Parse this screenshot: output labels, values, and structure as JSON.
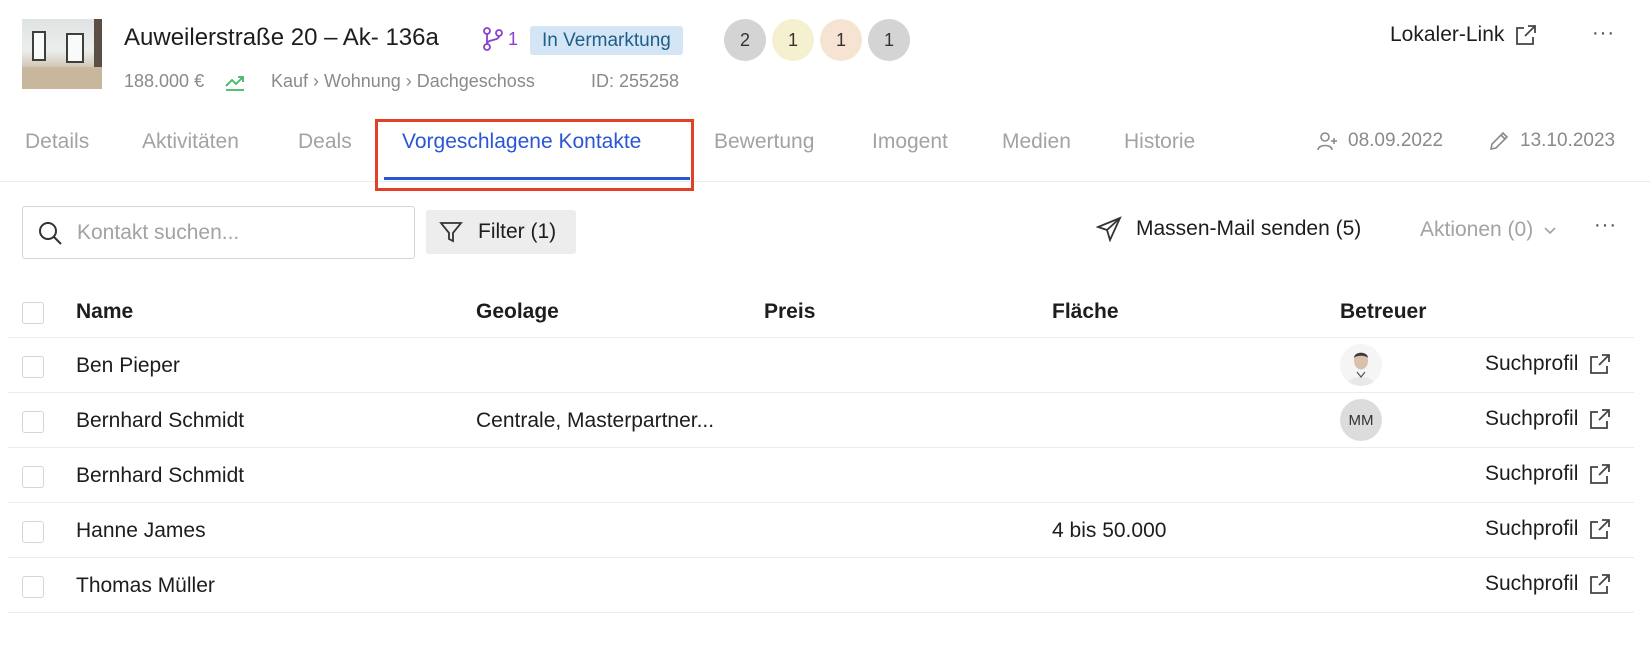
{
  "header": {
    "title": "Auweilerstraße 20 – Ak- 136a",
    "branch_count": "1",
    "status": "In Vermarktung",
    "circles": [
      {
        "value": "2",
        "color": "#d4d4d4"
      },
      {
        "value": "1",
        "color": "#f5f0cf"
      },
      {
        "value": "1",
        "color": "#f6e3d2"
      },
      {
        "value": "1",
        "color": "#d4d4d4"
      }
    ],
    "price": "188.000 €",
    "category": "Kauf › Wohnung › Dachgeschoss",
    "id_label": "ID: 255258",
    "local_link": "Lokaler-Link",
    "more_label": "···"
  },
  "tabs": [
    {
      "label": "Details",
      "key": "details"
    },
    {
      "label": "Aktivitäten",
      "key": "aktivitaeten"
    },
    {
      "label": "Deals",
      "key": "deals"
    },
    {
      "label": "Vorgeschlagene Kontakte",
      "key": "vorgeschlagene-kontakte",
      "active": true
    },
    {
      "label": "Bewertung",
      "key": "bewertung"
    },
    {
      "label": "Imogent",
      "key": "imogent"
    },
    {
      "label": "Medien",
      "key": "medien"
    },
    {
      "label": "Historie",
      "key": "historie"
    }
  ],
  "dates": {
    "created": "08.09.2022",
    "edited": "13.10.2023"
  },
  "toolbar": {
    "search_placeholder": "Kontakt suchen...",
    "filter_label": "Filter (1)",
    "mass_mail_label": "Massen-Mail senden (5)",
    "actions_label": "Aktionen (0)",
    "more_label": "···"
  },
  "table": {
    "columns": [
      "Name",
      "Geolage",
      "Preis",
      "Fläche",
      "Betreuer"
    ],
    "rows": [
      {
        "name": "Ben Pieper",
        "geolage": "",
        "preis": "",
        "flaeche": "",
        "betreuer": "photo",
        "link": "Suchprofil"
      },
      {
        "name": "Bernhard Schmidt",
        "geolage": "Centrale, Masterpartner...",
        "preis": "",
        "flaeche": "",
        "betreuer": "MM",
        "link": "Suchprofil"
      },
      {
        "name": "Bernhard Schmidt",
        "geolage": "",
        "preis": "",
        "flaeche": "",
        "betreuer": "",
        "link": "Suchprofil"
      },
      {
        "name": "Hanne James",
        "geolage": "",
        "preis": "",
        "flaeche": "4 bis 50.000",
        "betreuer": "",
        "link": "Suchprofil"
      },
      {
        "name": "Thomas Müller",
        "geolage": "",
        "preis": "",
        "flaeche": "",
        "betreuer": "",
        "link": "Suchprofil"
      }
    ]
  },
  "colors": {
    "accent": "#2a56d6",
    "highlight": "#e24128",
    "status_bg": "#d4e6f5",
    "branch": "#8a3fd1"
  }
}
